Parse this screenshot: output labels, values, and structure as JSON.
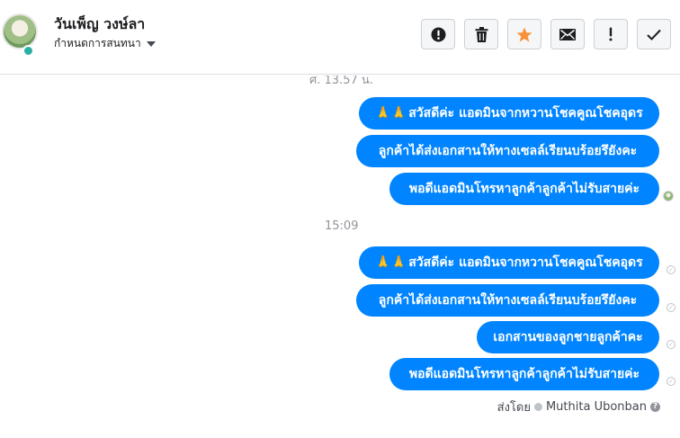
{
  "header": {
    "contact_name": "วันเพ็ญ วงษ์ลา",
    "assign_label": "กำหนดการสนทนา",
    "accent_color": "#0084ff",
    "actions": [
      {
        "name": "spam-button",
        "icon": "exclamation-circle-icon",
        "glyph": "!"
      },
      {
        "name": "delete-button",
        "icon": "trash-icon"
      },
      {
        "name": "star-button",
        "icon": "star-icon",
        "color": "#f7923b"
      },
      {
        "name": "mark-unread-button",
        "icon": "envelope-icon"
      },
      {
        "name": "follow-up-button",
        "icon": "exclamation-icon",
        "glyph": "!"
      },
      {
        "name": "done-button",
        "icon": "check-icon"
      }
    ]
  },
  "chat": {
    "timestamp_top": "ศ. 13.57 น.",
    "group1": [
      {
        "emoji": "🙏🙏",
        "text": "สวัสดีค่ะ แอดมินจากหวานโชคคูณโชคอุดร"
      },
      {
        "text": "ลูกค้าได้ส่งเอกสานให้ทางเซลล์เรียนบร้อยรึยังคะ"
      },
      {
        "text": "พอดีแอดมินโทรหาลูกค้าลูกค้าไม่รับสายค่ะ"
      }
    ],
    "timestamp_2": "15:09",
    "group2": [
      {
        "emoji": "🙏🙏",
        "text": "สวัสดีค่ะ แอดมินจากหวานโชคคูณโชคอุดร"
      },
      {
        "text": "ลูกค้าได้ส่งเอกสานให้ทางเซลล์เรียนบร้อยรึยังคะ"
      },
      {
        "text": "เอกสานของลูกชายลูกค้าคะ"
      },
      {
        "text": "พอดีแอดมินโทรหาลูกค้าลูกค้าไม่รับสายค่ะ"
      }
    ],
    "sent_by_label": "ส่งโดย",
    "sent_by_name": "Muthita Ubonban",
    "help_glyph": "?"
  }
}
